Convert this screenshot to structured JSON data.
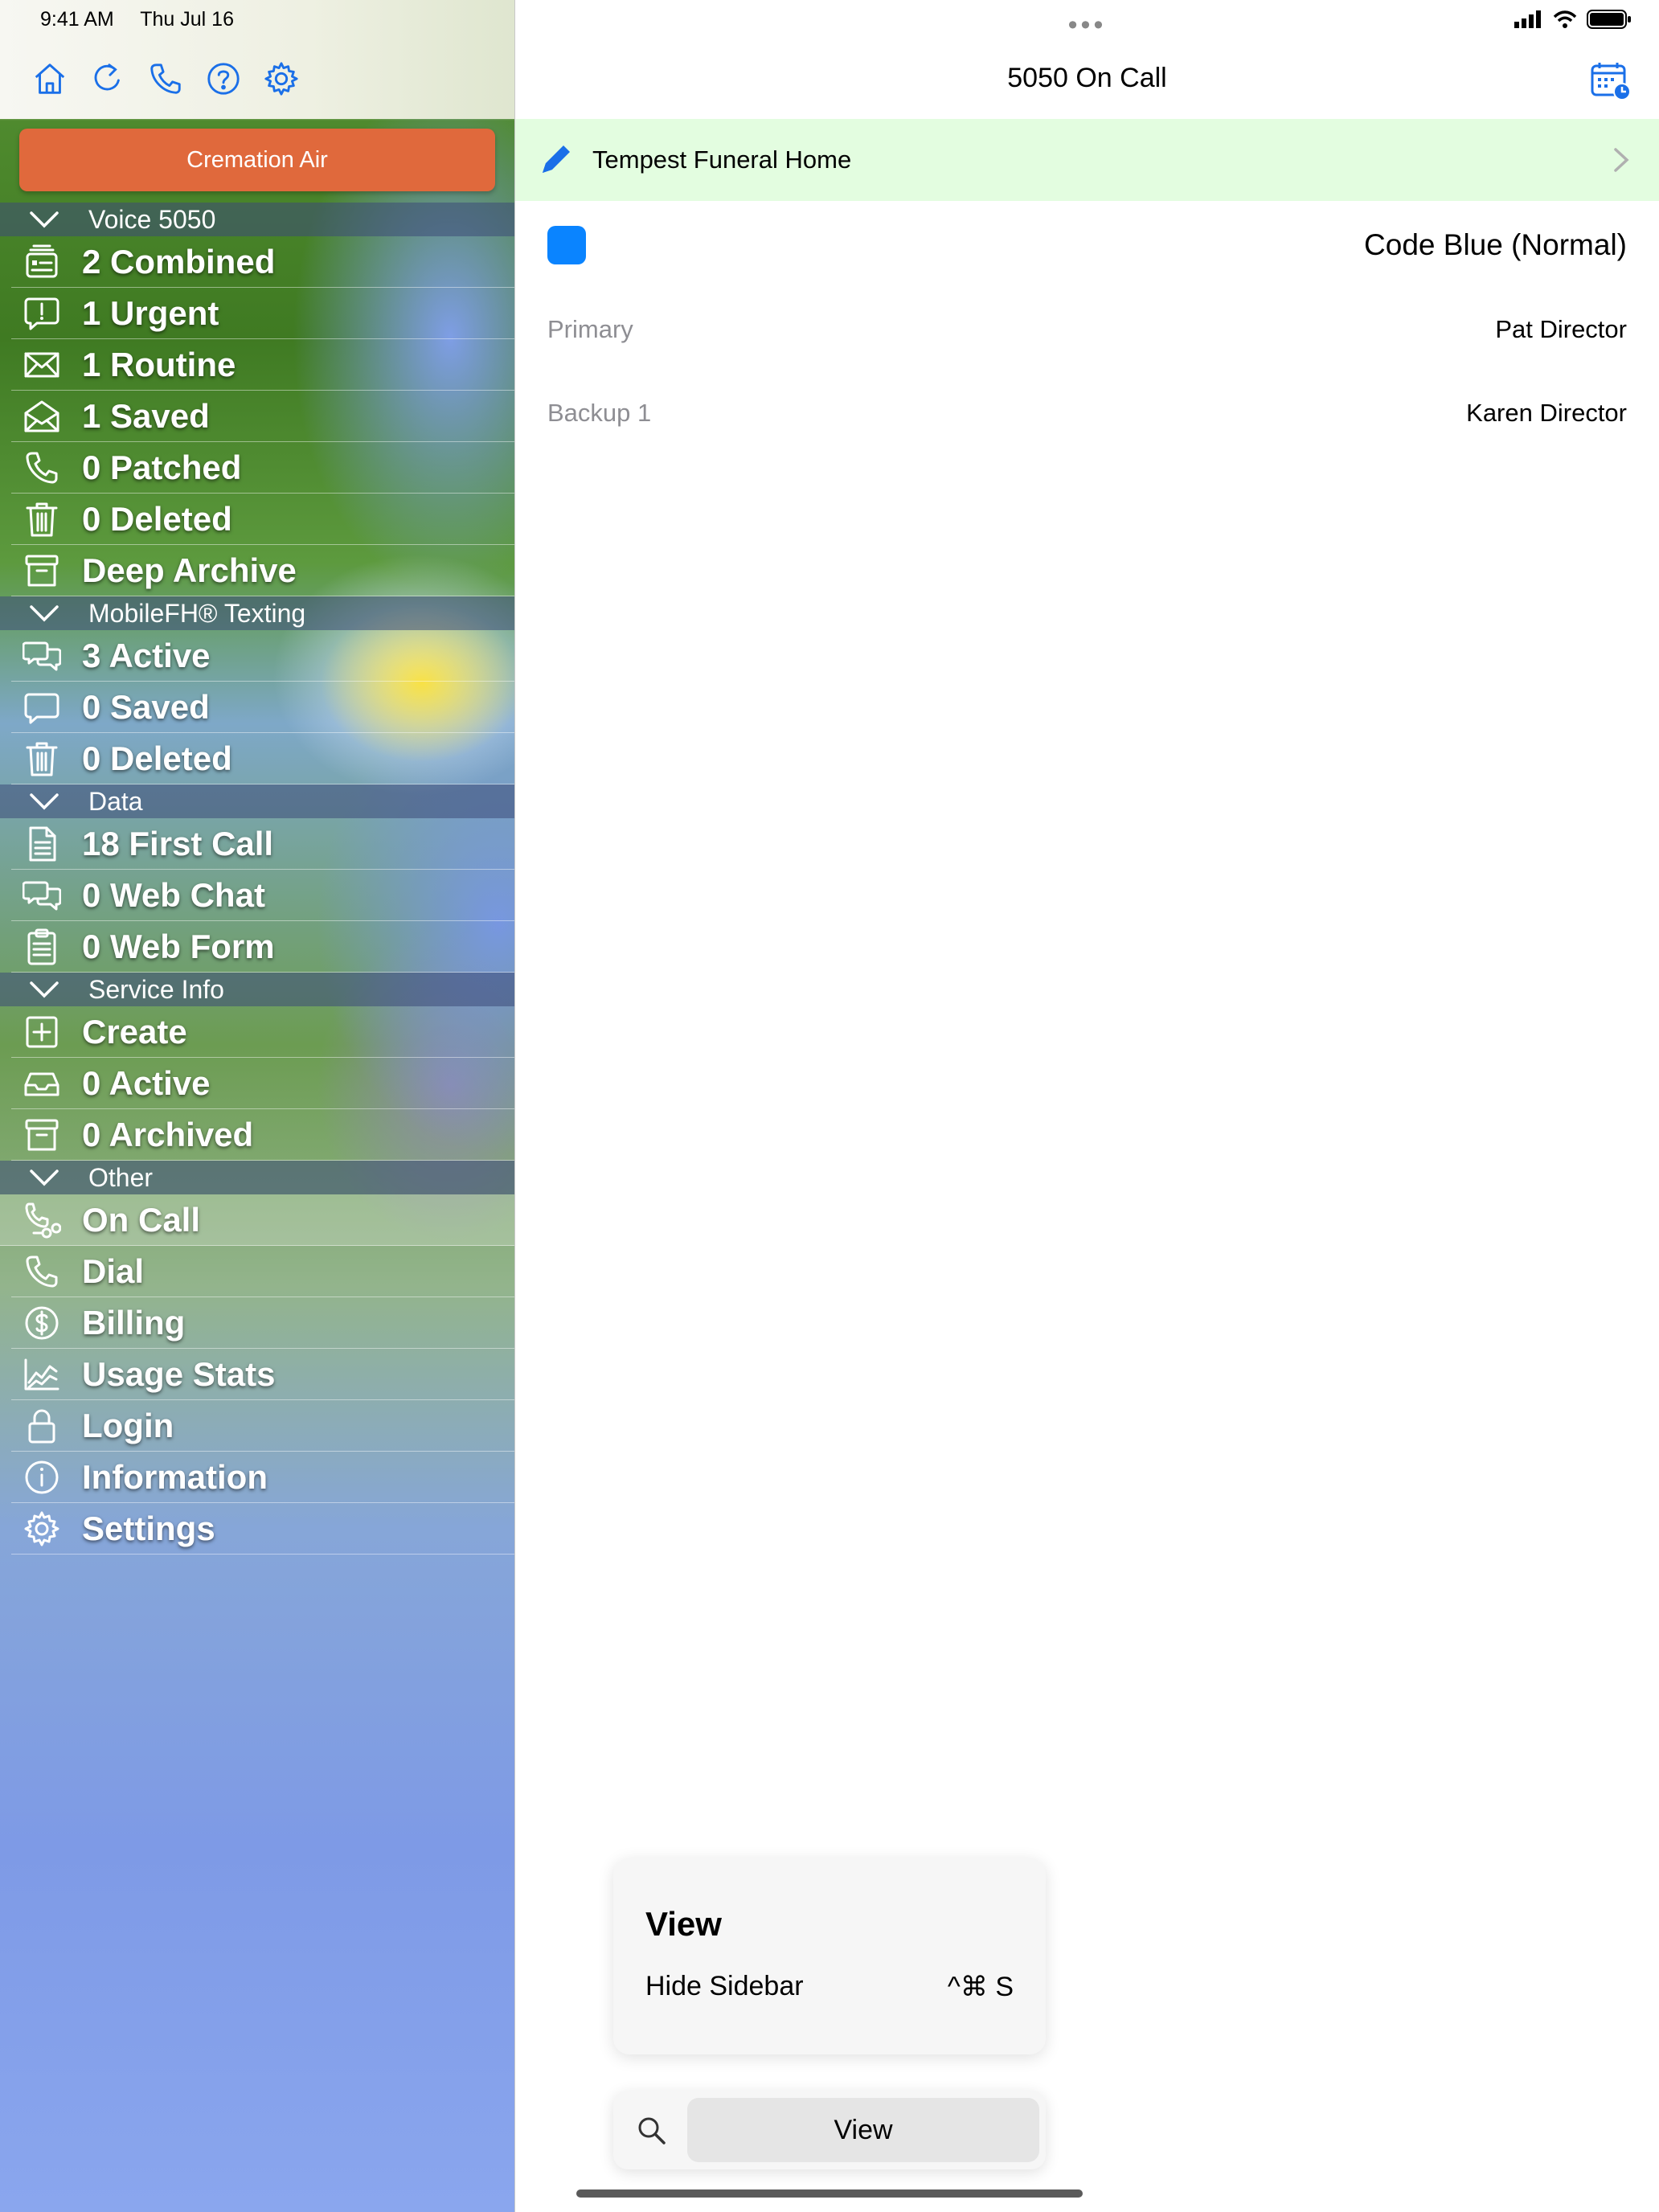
{
  "status": {
    "time": "9:41 AM",
    "date": "Thu Jul 16"
  },
  "toolbar": {
    "icons": [
      "home-icon",
      "refresh-icon",
      "phone-icon",
      "help-icon",
      "gear-icon"
    ]
  },
  "sidebar": {
    "button_label": "Cremation Air",
    "sections": [
      {
        "title": "Voice 5050",
        "items": [
          {
            "icon": "combined-icon",
            "label": "2 Combined"
          },
          {
            "icon": "urgent-icon",
            "label": "1 Urgent"
          },
          {
            "icon": "envelope-icon",
            "label": "1 Routine"
          },
          {
            "icon": "envelope-open-icon",
            "label": "1 Saved"
          },
          {
            "icon": "phone-icon",
            "label": "0 Patched"
          },
          {
            "icon": "trash-icon",
            "label": "0 Deleted"
          },
          {
            "icon": "archive-icon",
            "label": "Deep Archive"
          }
        ]
      },
      {
        "title": "MobileFH® Texting",
        "items": [
          {
            "icon": "chat-bubbles-icon",
            "label": "3 Active"
          },
          {
            "icon": "chat-bubble-icon",
            "label": "0 Saved"
          },
          {
            "icon": "trash-icon",
            "label": "0 Deleted"
          }
        ]
      },
      {
        "title": "Data",
        "items": [
          {
            "icon": "document-icon",
            "label": "18 First Call"
          },
          {
            "icon": "chat-bubbles-icon",
            "label": "0 Web Chat"
          },
          {
            "icon": "clipboard-icon",
            "label": "0 Web Form"
          }
        ]
      },
      {
        "title": "Service Info",
        "items": [
          {
            "icon": "plus-square-icon",
            "label": "Create"
          },
          {
            "icon": "tray-icon",
            "label": "0 Active"
          },
          {
            "icon": "archive-icon",
            "label": "0 Archived"
          }
        ]
      },
      {
        "title": "Other",
        "items": [
          {
            "icon": "on-call-icon",
            "label": "On Call",
            "active": true
          },
          {
            "icon": "phone-icon",
            "label": "Dial"
          },
          {
            "icon": "dollar-circle-icon",
            "label": "Billing"
          },
          {
            "icon": "chart-line-icon",
            "label": "Usage Stats"
          },
          {
            "icon": "lock-icon",
            "label": "Login"
          },
          {
            "icon": "info-icon",
            "label": "Information"
          },
          {
            "icon": "gear-icon",
            "label": "Settings"
          }
        ]
      }
    ]
  },
  "main": {
    "title": "5050 On Call",
    "funeral_home": "Tempest Funeral Home",
    "code": {
      "label": "Code Blue (Normal)",
      "color": "#0a84ff"
    },
    "rows": [
      {
        "key": "Primary",
        "value": "Pat Director"
      },
      {
        "key": "Backup 1",
        "value": "Karen Director"
      }
    ]
  },
  "popover": {
    "title": "View",
    "item_label": "Hide Sidebar",
    "shortcut": "^⌘ S"
  },
  "searchbar": {
    "button_label": "View"
  },
  "colors": {
    "accent": "#1a6fe8",
    "cremation_button": "#e0693c",
    "highlight_row": "#e3fde0"
  }
}
